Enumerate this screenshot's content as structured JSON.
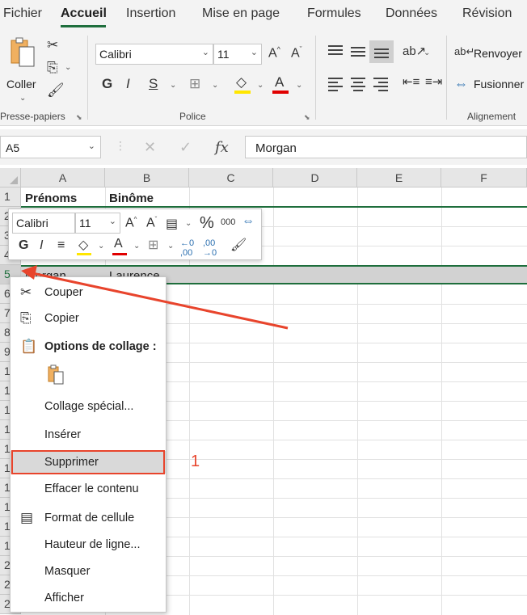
{
  "ribbon_tabs": [
    "Fichier",
    "Accueil",
    "Insertion",
    "Mise en page",
    "Formules",
    "Données",
    "Révision"
  ],
  "clipboard": {
    "paste_label": "Coller",
    "group_label": "Presse-papiers"
  },
  "font": {
    "name": "Calibri",
    "size": "11",
    "bold": "G",
    "italic": "I",
    "underline": "S",
    "group_label": "Police"
  },
  "alignment": {
    "wrap_label": "Renvoyer",
    "merge_label": "Fusionner",
    "group_label": "Alignement"
  },
  "formula_bar": {
    "name_box": "A5",
    "fx": "fx",
    "value": "Morgan"
  },
  "columns": [
    "A",
    "B",
    "C",
    "D",
    "E",
    "F"
  ],
  "rows": [
    "1",
    "2",
    "3",
    "4",
    "5",
    "6",
    "7",
    "8",
    "9",
    "1",
    "1",
    "1",
    "1",
    "1",
    "1",
    "1",
    "1",
    "1",
    "1",
    "2",
    "2",
    "2"
  ],
  "cells": {
    "a1": "Prénoms",
    "b1": "Binôme",
    "a5": "Morgan",
    "b5": "Laurence"
  },
  "mini_toolbar": {
    "font": "Calibri",
    "size": "11",
    "bold": "G",
    "italic": "I",
    "percent": "%",
    "thousands": "000"
  },
  "context_menu": {
    "items": [
      {
        "label": "Couper"
      },
      {
        "label": "Copier"
      },
      {
        "label": "Options de collage :"
      },
      {
        "label": "Collage spécial..."
      },
      {
        "label": "Insérer"
      },
      {
        "label": "Supprimer"
      },
      {
        "label": "Effacer le contenu"
      },
      {
        "label": "Format de cellule"
      },
      {
        "label": "Hauteur de ligne..."
      },
      {
        "label": "Masquer"
      },
      {
        "label": "Afficher"
      }
    ]
  },
  "annotation": {
    "step": "1",
    "color": "#e8442c"
  },
  "colors": {
    "excel_green": "#1e6e3c",
    "highlight_yellow": "#ffe600",
    "font_red": "#e00000"
  }
}
